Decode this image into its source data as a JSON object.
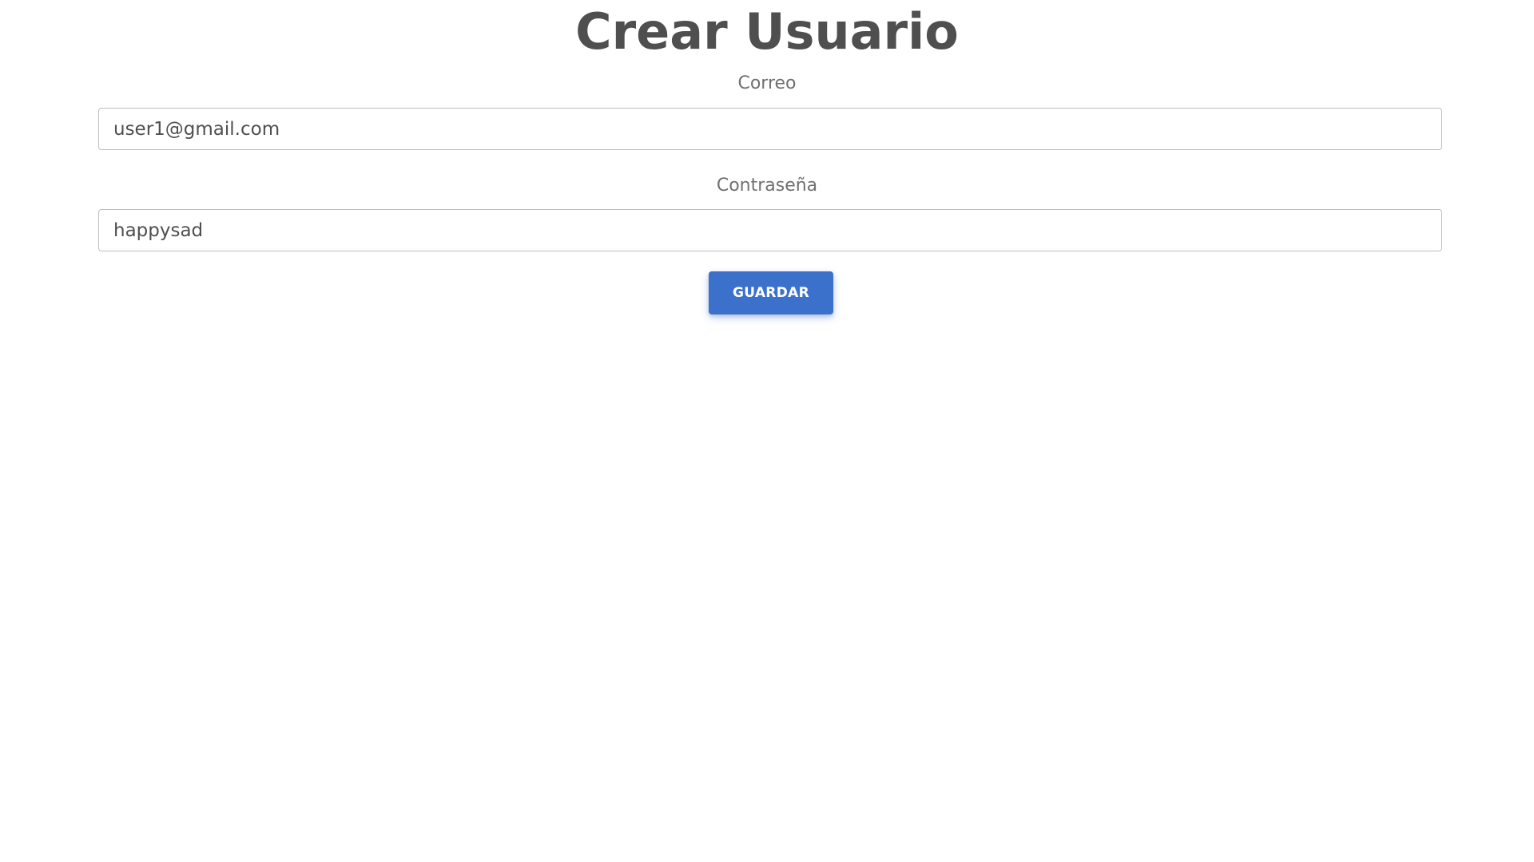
{
  "form": {
    "title": "Crear Usuario",
    "email_label": "Correo",
    "email_value": "user1@gmail.com",
    "password_label": "Contraseña",
    "password_value": "happysad",
    "save_label": "GUARDAR"
  },
  "colors": {
    "accent": "#3b71ca",
    "text": "#4f4f4f",
    "label": "#707070",
    "border": "#bdbdbd",
    "background": "#ffffff"
  }
}
